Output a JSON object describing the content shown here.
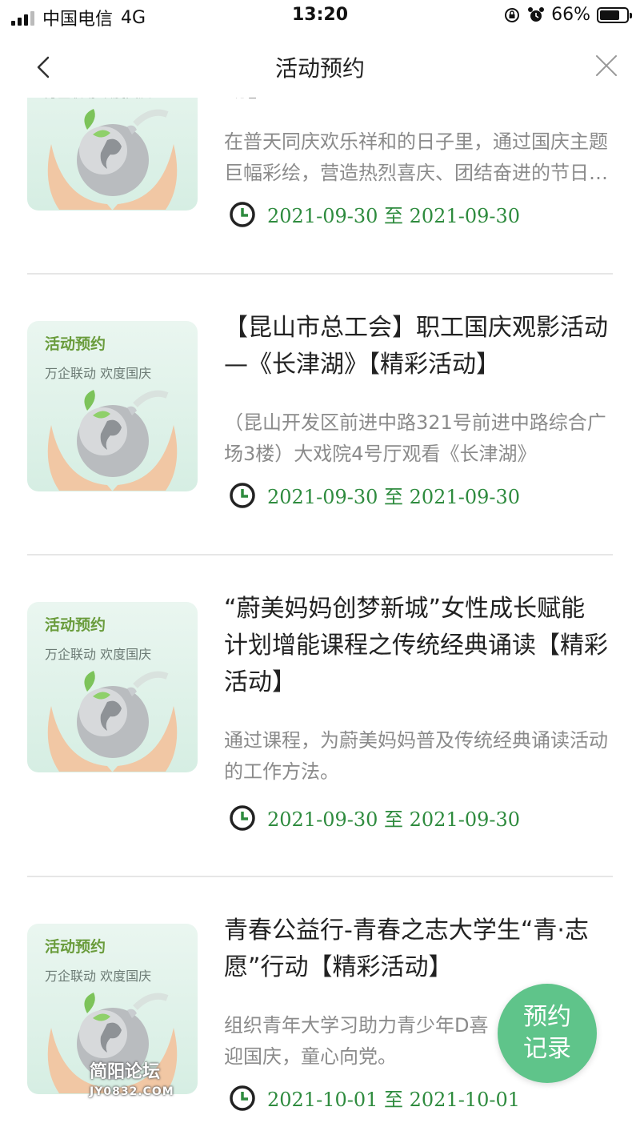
{
  "status_bar": {
    "carrier": "中国电信",
    "network": "4G",
    "time": "13:20",
    "battery": "66%",
    "battery_level": 0.66
  },
  "nav": {
    "title": "活动预约"
  },
  "thumbnail": {
    "tag": "活动预约",
    "subtitle": "万企联动 欢度国庆"
  },
  "activities": [
    {
      "title": "动】",
      "description": "在普天同庆欢乐祥和的日子里，通过国庆主题巨幅彩绘，营造热烈喜庆、团结奋进的节日氛围",
      "date": "2021-09-30 至 2021-09-30"
    },
    {
      "title": "【昆山市总工会】职工国庆观影活动—《长津湖》【精彩活动】",
      "description": "（昆山开发区前进中路321号前进中路综合广场3楼）大戏院4号厅观看《长津湖》",
      "date": "2021-09-30 至 2021-09-30"
    },
    {
      "title": "“蔚美妈妈创梦新城”女性成长赋能计划增能课程之传统经典诵读【精彩活动】",
      "description": "通过课程，为蔚美妈妈普及传统经典诵读活动的工作方法。",
      "date": "2021-09-30 至 2021-09-30"
    },
    {
      "title": "青春公益行-青春之志大学生“青·志愿”行动【精彩活动】",
      "description": "组织青年大学习助力青少年D喜迎国庆，童心向党。",
      "date": "2021-10-01 至 2021-10-01"
    }
  ],
  "fab": {
    "line1": "预约",
    "line2": "记录"
  },
  "watermark": {
    "line1": "简阳论坛",
    "line2": "JY0832.COM"
  },
  "colors": {
    "accent": "#2e8b3e",
    "fab": "#5fc48a",
    "thumb_tag": "#6a9c3c"
  }
}
